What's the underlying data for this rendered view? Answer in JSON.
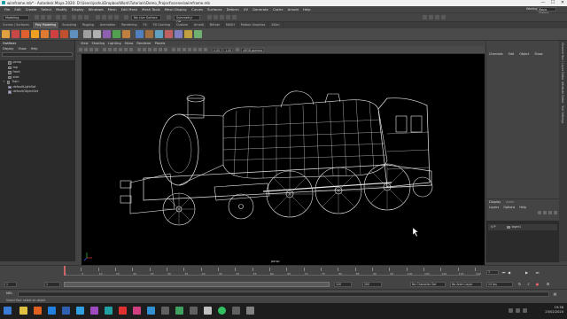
{
  "window": {
    "title": "wireframe.mb* - Autodesk Maya 2020: D:\\Users\\joshu\\Dropbox\\Work\\Tutorials\\Demo_Project\\scenes\\wireframe.mb",
    "minimize": "—",
    "maximize": "☐",
    "close": "✕"
  },
  "menubar": {
    "items": [
      "File",
      "Edit",
      "Create",
      "Select",
      "Modify",
      "Display",
      "Windows",
      "Mesh",
      "Edit Mesh",
      "Mesh Tools",
      "Mesh Display",
      "Curves",
      "Surfaces",
      "Deform",
      "UV",
      "Generate",
      "Cache",
      "Arnold",
      "Help"
    ],
    "workspace_label": "Workspace :",
    "workspace_value": "Maya Classic"
  },
  "statusline": {
    "mode": "Modeling",
    "live_surface": "No Live Surface",
    "symmetry": "Symmetry: Off"
  },
  "shelf": {
    "tabs": [
      "Curves / Surfaces",
      "Poly Modeling",
      "Sculpting",
      "Rigging",
      "Animation",
      "Rendering",
      "FX",
      "FX Caching",
      "Custom",
      "Arnold",
      "Bifrost",
      "MASH",
      "Motion Graphics",
      "XGen"
    ],
    "active_tab": "Poly Modeling",
    "icon_colors": [
      "#e0a040",
      "#c84848",
      "#e06030",
      "#f0a020",
      "#e07a30",
      "#d04040",
      "#c05030",
      "#6090c0",
      "#a0a0a0",
      "#b0b0b0",
      "#9060b0",
      "#50a050",
      "#c08040",
      "#5080c0",
      "#a07040",
      "#60a0c0",
      "#c06060",
      "#8080c0",
      "#c0a040",
      "#70b070"
    ]
  },
  "outliner": {
    "title": "Outliner",
    "menus": [
      "Display",
      "Show",
      "Help"
    ],
    "items": [
      {
        "label": "persp",
        "kind": "camera"
      },
      {
        "label": "top",
        "kind": "camera"
      },
      {
        "label": "front",
        "kind": "camera"
      },
      {
        "label": "side",
        "kind": "camera"
      },
      {
        "label": "Train",
        "kind": "group"
      },
      {
        "label": "defaultLightSet",
        "kind": "set"
      },
      {
        "label": "defaultObjectSet",
        "kind": "set"
      }
    ]
  },
  "viewport": {
    "menus": [
      "View",
      "Shading",
      "Lighting",
      "Show",
      "Renderer",
      "Panels"
    ],
    "near_value": "0.00",
    "far_value": "1.00",
    "color_space": "sRGB gamma",
    "camera_name": "persp"
  },
  "channelbox": {
    "menus": [
      "Channels",
      "Edit",
      "Object",
      "Show"
    ]
  },
  "layers": {
    "tabs": [
      "Display",
      "Anim"
    ],
    "menus": [
      "Layers",
      "Options",
      "Help"
    ],
    "layer_flags": "V P",
    "layer_name": "layer1"
  },
  "sidetabs": [
    "Channel Box / Layer Editor",
    "Attribute Editor",
    "Tool Settings"
  ],
  "timeslider": {
    "labels": [
      "1",
      "5",
      "10",
      "15",
      "20",
      "25",
      "30",
      "35",
      "40",
      "45",
      "50",
      "55",
      "60",
      "65",
      "70",
      "75",
      "80",
      "85",
      "90",
      "95",
      "100",
      "105",
      "110",
      "115",
      "120"
    ],
    "current_frame": "1"
  },
  "rangeslider": {
    "start": "1",
    "start_inner": "1",
    "end_inner": "120",
    "end": "120",
    "end_outer": "200",
    "character_set": "No Character Set",
    "anim_layer": "No Anim Layer",
    "fps": "24 fps"
  },
  "cmdline": {
    "label": "MEL"
  },
  "helpline": {
    "text": "Select Tool: select an object"
  },
  "taskbar": {
    "icon_colors": [
      "#3a7bd5",
      "#e0c040",
      "#e06020",
      "#2080e0",
      "#3060b0",
      "#30a0e0",
      "#a04ac0",
      "#20a0a0",
      "#e03030",
      "#d04080",
      "#3090d0",
      "#606060",
      "#40a060",
      "#606060",
      "#c0c0c0",
      "#30c060",
      "#606060",
      "#808080"
    ],
    "time": "19:36",
    "date": "25/02/2020"
  }
}
